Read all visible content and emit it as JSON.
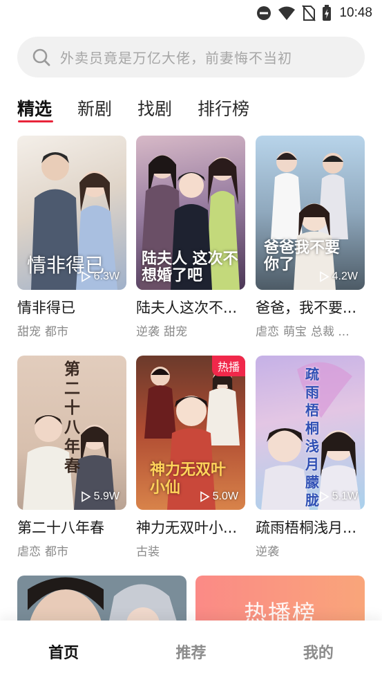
{
  "status_bar": {
    "time": "10:48",
    "icons": [
      "do-not-disturb-icon",
      "wifi-icon",
      "no-sim-icon",
      "battery-charging-icon"
    ]
  },
  "search": {
    "placeholder": "外卖员竟是万亿大佬，前妻悔不当初",
    "icon": "search-icon"
  },
  "tabs": [
    {
      "label": "精选",
      "active": true
    },
    {
      "label": "新剧",
      "active": false
    },
    {
      "label": "找剧",
      "active": false
    },
    {
      "label": "排行榜",
      "active": false
    }
  ],
  "accent_color": "#e8243a",
  "cards": [
    {
      "title": "情非得已",
      "tags": [
        "甜宠",
        "都市"
      ],
      "views": "6.3W",
      "poster_text": "情非得已",
      "badge": ""
    },
    {
      "title": "陆夫人这次不...",
      "tags": [
        "逆袭",
        "甜宠"
      ],
      "views": "",
      "poster_text": "陆夫人 这次不想婚了吧",
      "badge": ""
    },
    {
      "title": "爸爸，我不要...",
      "tags": [
        "虐恋",
        "萌宝",
        "总裁 ..."
      ],
      "views": "4.2W",
      "poster_text": "爸爸我不要你了",
      "badge": ""
    },
    {
      "title": "第二十八年春",
      "tags": [
        "虐恋",
        "都市"
      ],
      "views": "5.9W",
      "poster_text": "第二十八年春",
      "badge": ""
    },
    {
      "title": "神力无双叶小...",
      "tags": [
        "古装"
      ],
      "views": "5.0W",
      "poster_text": "神力无双叶小仙",
      "badge": "热播"
    },
    {
      "title": "疏雨梧桐浅月...",
      "tags": [
        "逆袭"
      ],
      "views": "5.1W",
      "poster_text": "疏雨梧桐浅月朦胧",
      "badge": ""
    }
  ],
  "banners": {
    "right_label": "热播榜"
  },
  "bottom_nav": [
    {
      "label": "首页",
      "active": true
    },
    {
      "label": "推荐",
      "active": false
    },
    {
      "label": "我的",
      "active": false
    }
  ]
}
